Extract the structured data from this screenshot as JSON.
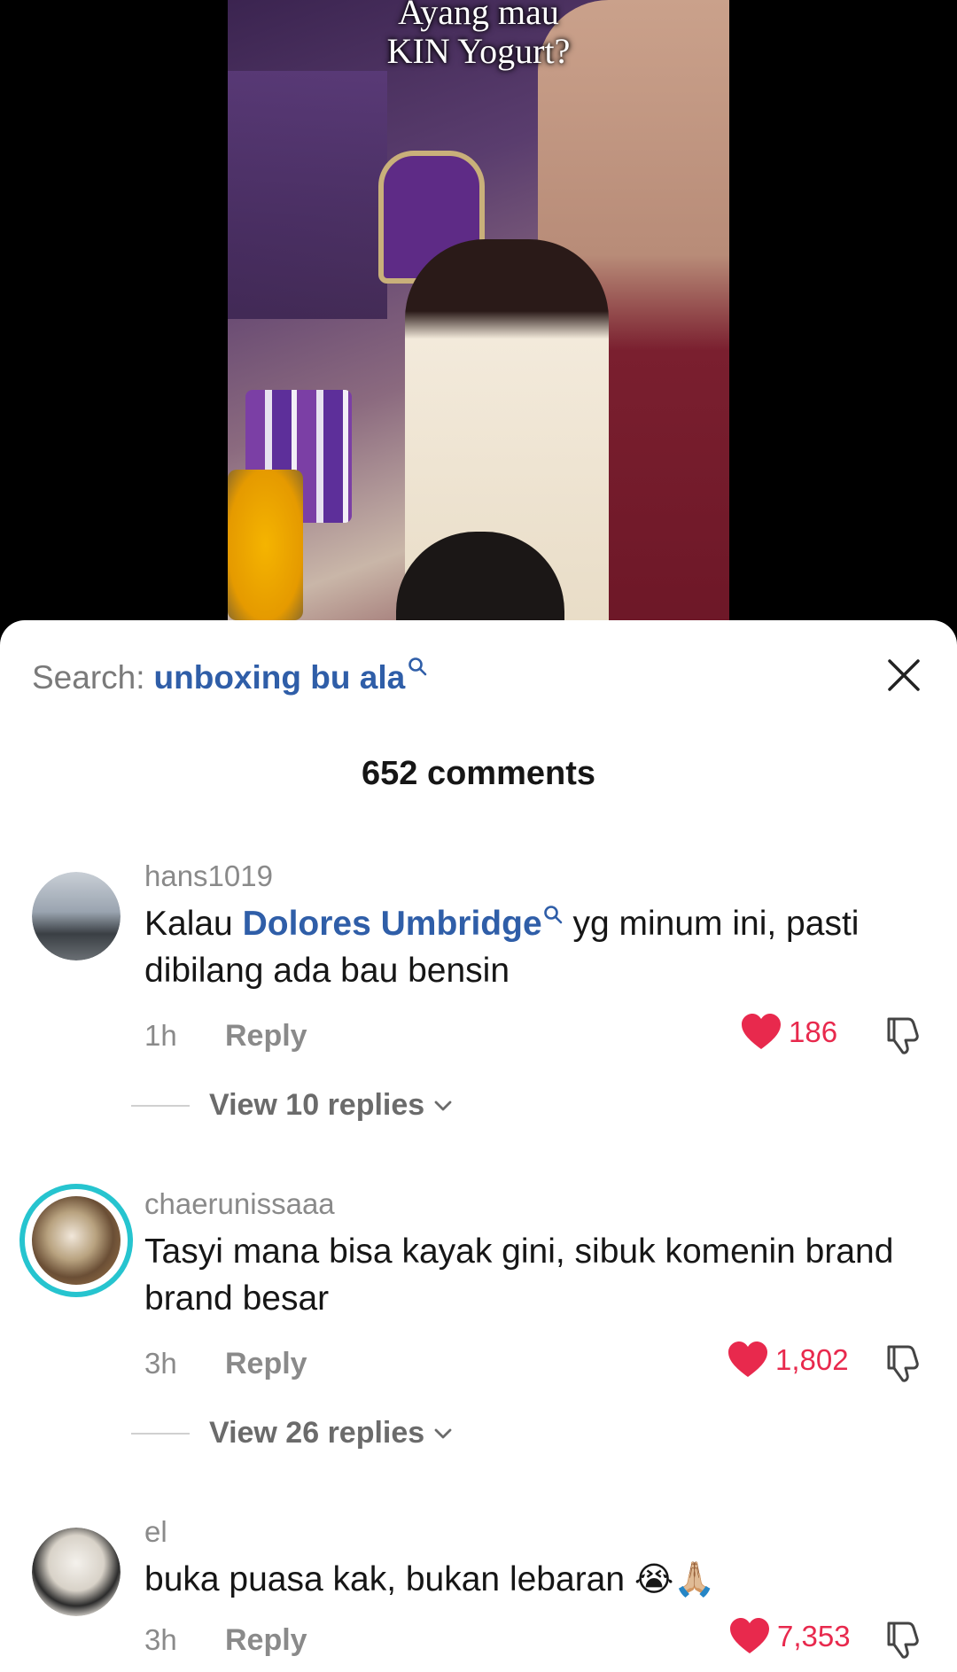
{
  "video": {
    "caption_line1": "Ayang mau",
    "caption_line2": "KIN Yogurt?"
  },
  "search": {
    "label": "Search:",
    "term": "unboxing bu ala"
  },
  "comments_header": "652 comments",
  "comments": [
    {
      "username": "hans1019",
      "text_before": "Kalau ",
      "mention": "Dolores Umbridge",
      "text_after": " yg minum ini, pasti dibilang ada bau bensin",
      "time": "1h",
      "reply_label": "Reply",
      "likes": "186",
      "view_replies": "View 10 replies"
    },
    {
      "username": "chaerunissaaa",
      "text": "Tasyi mana bisa kayak gini, sibuk komenin brand brand besar",
      "time": "3h",
      "reply_label": "Reply",
      "likes": "1,802",
      "view_replies": "View 26 replies"
    },
    {
      "username": "el",
      "text": "buka puasa kak, bukan lebaran",
      "emoji": "😭🙏🏼",
      "time": "3h",
      "reply_label": "Reply",
      "likes": "7,353"
    }
  ],
  "colors": {
    "accent_link": "#2f5ea8",
    "like_red": "#e8294d",
    "story_ring": "#26c4cf"
  }
}
